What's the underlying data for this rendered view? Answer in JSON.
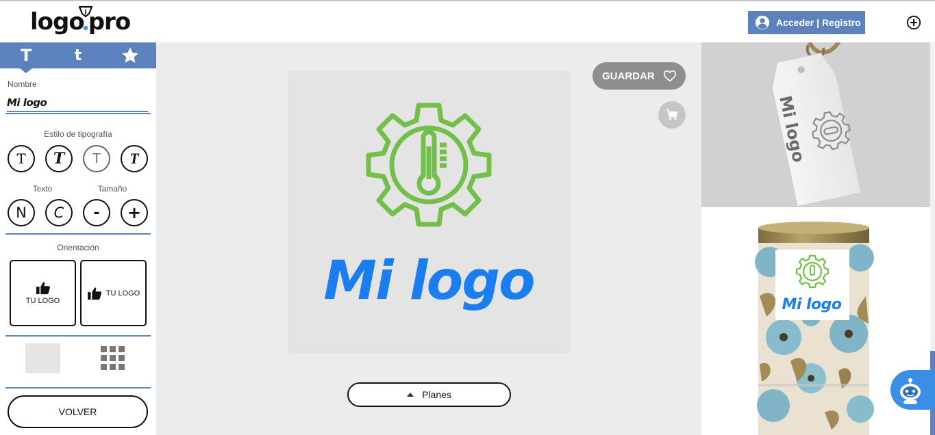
{
  "header": {
    "brand": "logo",
    "brand_suffix": "pro",
    "auth_button": "Acceder | Registro",
    "icons": {
      "user": "user-circle-icon",
      "add": "plus-circle-icon",
      "pen": "pen-nib-icon"
    }
  },
  "sidebar": {
    "tabs": [
      {
        "label": "T",
        "icon": "font-family-icon"
      },
      {
        "label": "t",
        "icon": "font-style-icon"
      },
      {
        "label": "",
        "icon": "star-icon"
      }
    ],
    "name_label": "Nombre",
    "name_value": "Mi logo",
    "typography_label": "Estilo de tipografía",
    "typography_options": [
      "T",
      "T",
      "T",
      "T"
    ],
    "text_label": "Texto",
    "size_label": "Tamaño",
    "text_options": [
      "N",
      "C"
    ],
    "size_options": [
      "-",
      "+"
    ],
    "orientation_label": "Orientación",
    "orientation_options": [
      "TU LOGO",
      "TU LOGO"
    ],
    "back_button": "VOLVER"
  },
  "canvas": {
    "logo_text": "Mi logo",
    "save_button": "GUARDAR",
    "plans_button": "Planes",
    "icon": "gear-thermometer-icon"
  },
  "mockups": {
    "tag_text": "Mi logo",
    "tin_text": "Mi logo"
  },
  "colors": {
    "accent": "#5b82bd",
    "logo_text": "#1a7df0",
    "logo_icon": "#72c04a",
    "canvas_bg": "#eaecee"
  }
}
